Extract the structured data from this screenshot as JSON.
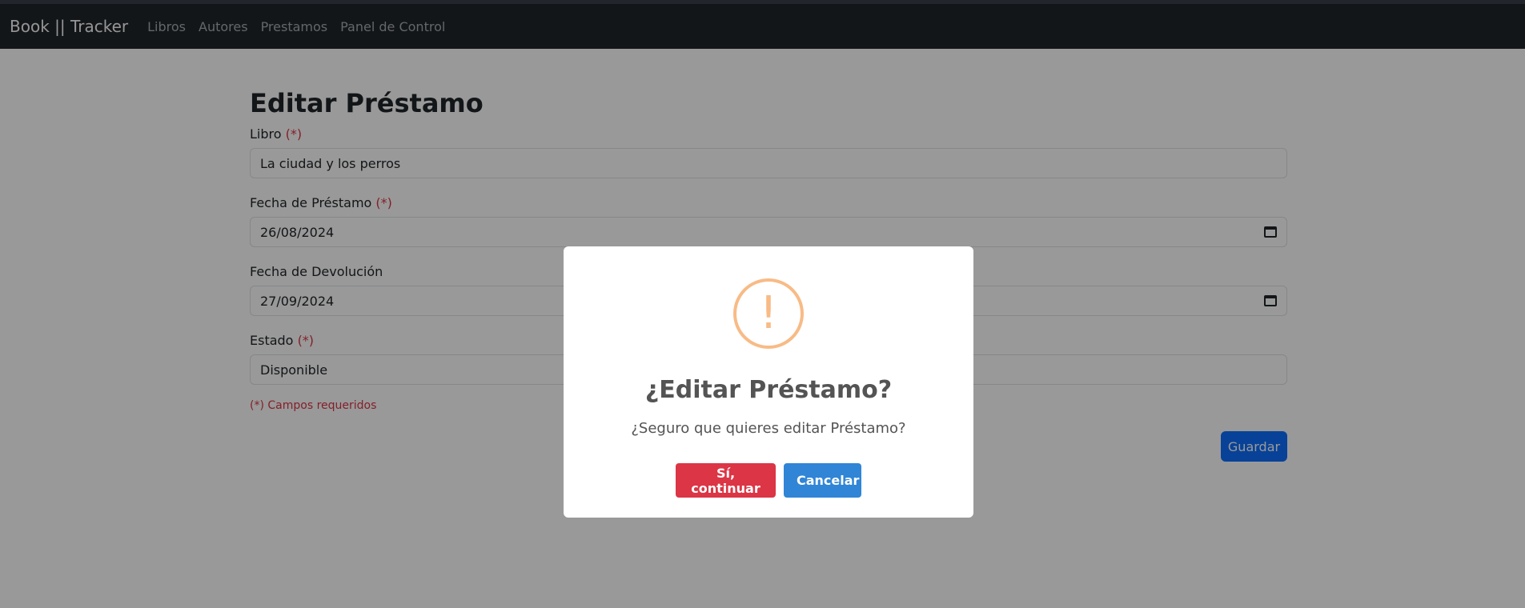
{
  "navbar": {
    "brand": "Book || Tracker",
    "links": [
      "Libros",
      "Autores",
      "Prestamos",
      "Panel de Control"
    ]
  },
  "form": {
    "title": "Editar Préstamo",
    "required_marker": "(*)",
    "fields": [
      {
        "label": "Libro",
        "value": "La ciudad y los perros"
      },
      {
        "label": "Fecha de Préstamo",
        "value": "26/08/2024"
      },
      {
        "label": "Fecha de Devolución",
        "value": "27/09/2024"
      },
      {
        "label": "Estado",
        "value": "Disponible"
      }
    ],
    "required_note": "(*) Campos requeridos",
    "submit_label": "Guardar"
  },
  "modal": {
    "icon": "warning-exclamation-icon",
    "icon_glyph": "!",
    "title": "¿Editar Préstamo?",
    "text": "¿Seguro que quieres editar Préstamo?",
    "confirm_label": "Sí, continuar",
    "cancel_label": "Cancelar"
  },
  "colors": {
    "confirm": "#dc3545",
    "cancel": "#3085d6",
    "primary": "#0d6efd",
    "warning_icon": "#f8bb86"
  }
}
